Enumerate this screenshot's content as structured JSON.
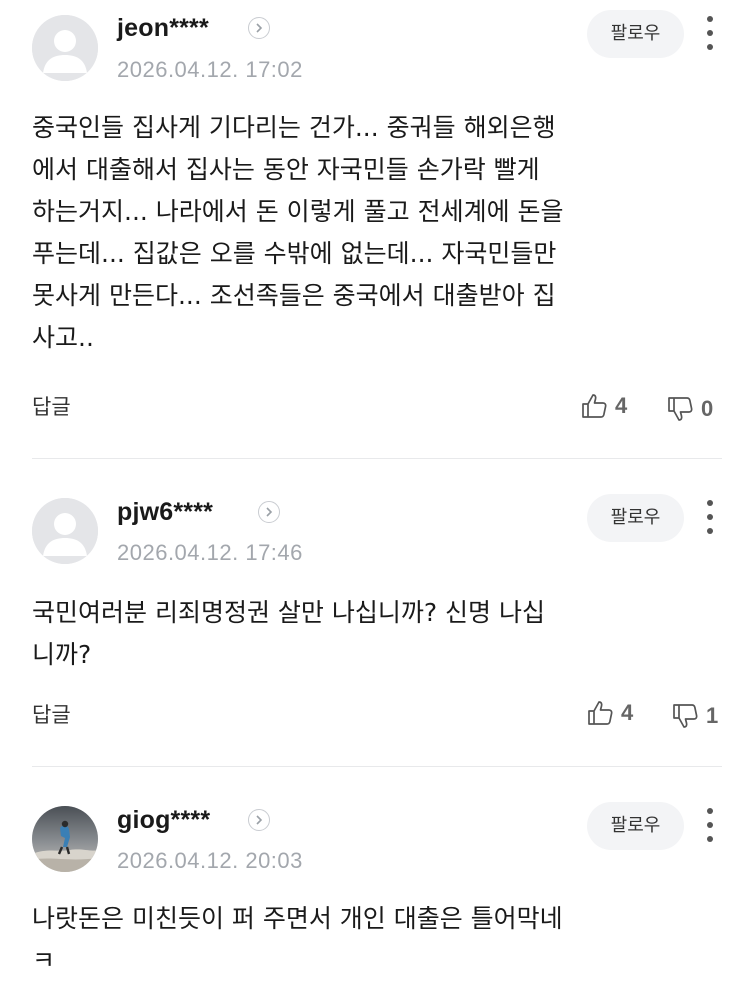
{
  "colors": {
    "text": "#1a1a1a",
    "meta": "#a3a7ad",
    "button_bg": "#f3f4f6"
  },
  "comments": [
    {
      "username": "jeon****",
      "timestamp": "2026.04.12. 17:02",
      "follow_label": "팔로우",
      "avatar": "default-avatar",
      "text": "중국인들 집사게 기다리는 건가... 중궈들 해외은행\n에서 대출해서 집사는 동안 자국민들 손가락 빨게\n하는거지... 나라에서 돈 이렇게 풀고 전세계에 돈을\n푸는데... 집값은 오를 수밖에 없는데... 자국민들만\n못사게 만든다... 조선족들은 중국에서 대출받아 집\n사고..",
      "reply_label": "답글",
      "likes": "4",
      "dislikes": "0"
    },
    {
      "username": "pjw6****",
      "timestamp": "2026.04.12. 17:46",
      "follow_label": "팔로우",
      "avatar": "default-avatar",
      "text": "국민여러분 리죄명정권 살만 나십니까? 신명 나십\n니까?",
      "reply_label": "답글",
      "likes": "4",
      "dislikes": "1"
    },
    {
      "username": "giog****",
      "timestamp": "2026.04.12. 20:03",
      "follow_label": "팔로우",
      "avatar": "photo-avatar",
      "text": "나랏돈은 미친듯이 퍼 주면서 개인 대출은 틀어막네\nㅋ"
    }
  ]
}
